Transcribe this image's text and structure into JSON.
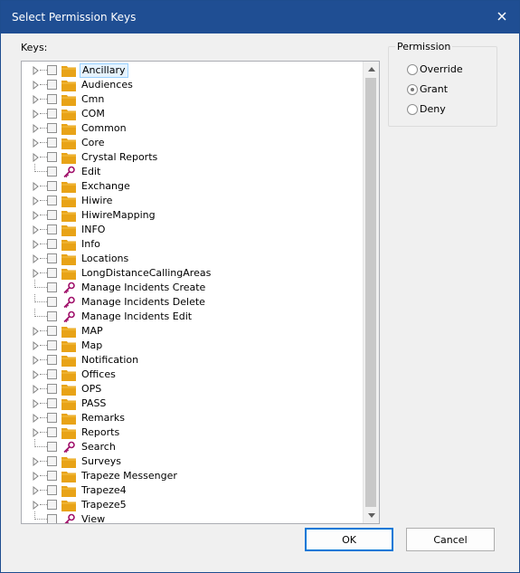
{
  "window": {
    "title": "Select Permission Keys",
    "close_icon": "close-icon"
  },
  "keys_label": "Keys:",
  "tree": {
    "items": [
      {
        "label": "Ancillary",
        "type": "folder",
        "selected": true
      },
      {
        "label": "Audiences",
        "type": "folder"
      },
      {
        "label": "Cmn",
        "type": "folder"
      },
      {
        "label": "COM",
        "type": "folder"
      },
      {
        "label": "Common",
        "type": "folder"
      },
      {
        "label": "Core",
        "type": "folder"
      },
      {
        "label": "Crystal Reports",
        "type": "folder"
      },
      {
        "label": "Edit",
        "type": "key"
      },
      {
        "label": "Exchange",
        "type": "folder"
      },
      {
        "label": "Hiwire",
        "type": "folder"
      },
      {
        "label": "HiwireMapping",
        "type": "folder"
      },
      {
        "label": "INFO",
        "type": "folder"
      },
      {
        "label": "Info",
        "type": "folder"
      },
      {
        "label": "Locations",
        "type": "folder"
      },
      {
        "label": "LongDistanceCallingAreas",
        "type": "folder"
      },
      {
        "label": "Manage Incidents Create",
        "type": "key"
      },
      {
        "label": "Manage Incidents Delete",
        "type": "key"
      },
      {
        "label": "Manage Incidents Edit",
        "type": "key"
      },
      {
        "label": "MAP",
        "type": "folder"
      },
      {
        "label": "Map",
        "type": "folder"
      },
      {
        "label": "Notification",
        "type": "folder"
      },
      {
        "label": "Offices",
        "type": "folder"
      },
      {
        "label": "OPS",
        "type": "folder"
      },
      {
        "label": "PASS",
        "type": "folder"
      },
      {
        "label": "Remarks",
        "type": "folder"
      },
      {
        "label": "Reports",
        "type": "folder"
      },
      {
        "label": "Search",
        "type": "key"
      },
      {
        "label": "Surveys",
        "type": "folder"
      },
      {
        "label": "Trapeze Messenger",
        "type": "folder"
      },
      {
        "label": "Trapeze4",
        "type": "folder"
      },
      {
        "label": "Trapeze5",
        "type": "folder"
      },
      {
        "label": "View",
        "type": "key"
      }
    ]
  },
  "permission": {
    "legend": "Permission",
    "options": [
      {
        "label": "Override",
        "checked": false
      },
      {
        "label": "Grant",
        "checked": true
      },
      {
        "label": "Deny",
        "checked": false
      }
    ]
  },
  "buttons": {
    "ok": "OK",
    "cancel": "Cancel"
  },
  "colors": {
    "titlebar": "#1f4e93",
    "folder": "#e8a317",
    "key": "#a0106a",
    "selection": "#e5f3ff"
  }
}
